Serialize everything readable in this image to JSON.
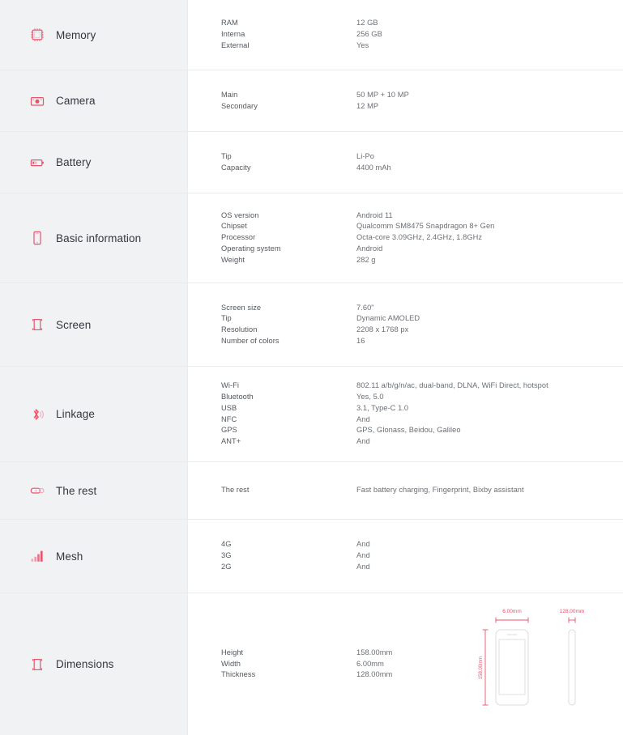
{
  "sections": [
    {
      "id": "memory",
      "title": "Memory",
      "icon": "memory-chip-icon",
      "rows": [
        {
          "key": "RAM",
          "value": "12 GB"
        },
        {
          "key": "Interna",
          "value": "256 GB"
        },
        {
          "key": "External",
          "value": "Yes"
        }
      ]
    },
    {
      "id": "camera",
      "title": "Camera",
      "icon": "camera-icon",
      "rows": [
        {
          "key": "Main",
          "value": "50 MP + 10 MP"
        },
        {
          "key": "Secondary",
          "value": "12 MP"
        }
      ]
    },
    {
      "id": "battery",
      "title": "Battery",
      "icon": "battery-icon",
      "rows": [
        {
          "key": "Tip",
          "value": "Li-Po"
        },
        {
          "key": "Capacity",
          "value": "4400 mAh"
        }
      ]
    },
    {
      "id": "basic-information",
      "title": "Basic information",
      "icon": "phone-icon",
      "rows": [
        {
          "key": "OS version",
          "value": "Android 11"
        },
        {
          "key": "Chipset",
          "value": "Qualcomm SM8475 Snapdragon 8+ Gen"
        },
        {
          "key": "Processor",
          "value": "Octa-core 3.09GHz, 2.4GHz, 1.8GHz"
        },
        {
          "key": "Operating system",
          "value": "Android"
        },
        {
          "key": "Weight",
          "value": "282 g"
        }
      ]
    },
    {
      "id": "screen",
      "title": "Screen",
      "icon": "screen-frame-icon",
      "rows": [
        {
          "key": "Screen size",
          "value": "7.60\""
        },
        {
          "key": "Tip",
          "value": "Dynamic AMOLED"
        },
        {
          "key": "Resolution",
          "value": "2208 x 1768 px"
        },
        {
          "key": "Number of colors",
          "value": "16"
        }
      ]
    },
    {
      "id": "linkage",
      "title": "Linkage",
      "icon": "bluetooth-icon",
      "rows": [
        {
          "key": "Wi-Fi",
          "value": "802.11 a/b/g/n/ac, dual-band, DLNA, WiFi Direct, hotspot"
        },
        {
          "key": "Bluetooth",
          "value": "Yes, 5.0"
        },
        {
          "key": "USB",
          "value": "3.1, Type-C 1.0"
        },
        {
          "key": "NFC",
          "value": "And"
        },
        {
          "key": "GPS",
          "value": "GPS, Glonass, Beidou, Galileo"
        },
        {
          "key": "ANT+",
          "value": "And"
        }
      ]
    },
    {
      "id": "the-rest",
      "title": "The rest",
      "icon": "vr-glasses-icon",
      "rows": [
        {
          "key": "The rest",
          "value": "Fast battery charging, Fingerprint, Bixby assistant"
        }
      ]
    },
    {
      "id": "mesh",
      "title": "Mesh",
      "icon": "signal-bars-icon",
      "rows": [
        {
          "key": "4G",
          "value": "And"
        },
        {
          "key": "3G",
          "value": "And"
        },
        {
          "key": "2G",
          "value": "And"
        }
      ]
    },
    {
      "id": "dimensions",
      "title": "Dimensions",
      "icon": "dimensions-icon",
      "rows": [
        {
          "key": "Height",
          "value": "158.00mm"
        },
        {
          "key": "Width",
          "value": "6.00mm"
        },
        {
          "key": "Thickness",
          "value": "128.00mm"
        }
      ]
    }
  ],
  "diagram": {
    "width_label": "6.00mm",
    "thickness_label": "128.00mm",
    "height_label": "158.00mm"
  },
  "colors": {
    "accent": "#e8536c",
    "accent_light": "#f3a9b6",
    "sidebar_bg": "#f1f2f4",
    "body_bg": "#ffffff",
    "divider": "#e9eaec",
    "key_text": "#53585e",
    "value_text": "#6a6f75",
    "title_text": "#33383d"
  }
}
